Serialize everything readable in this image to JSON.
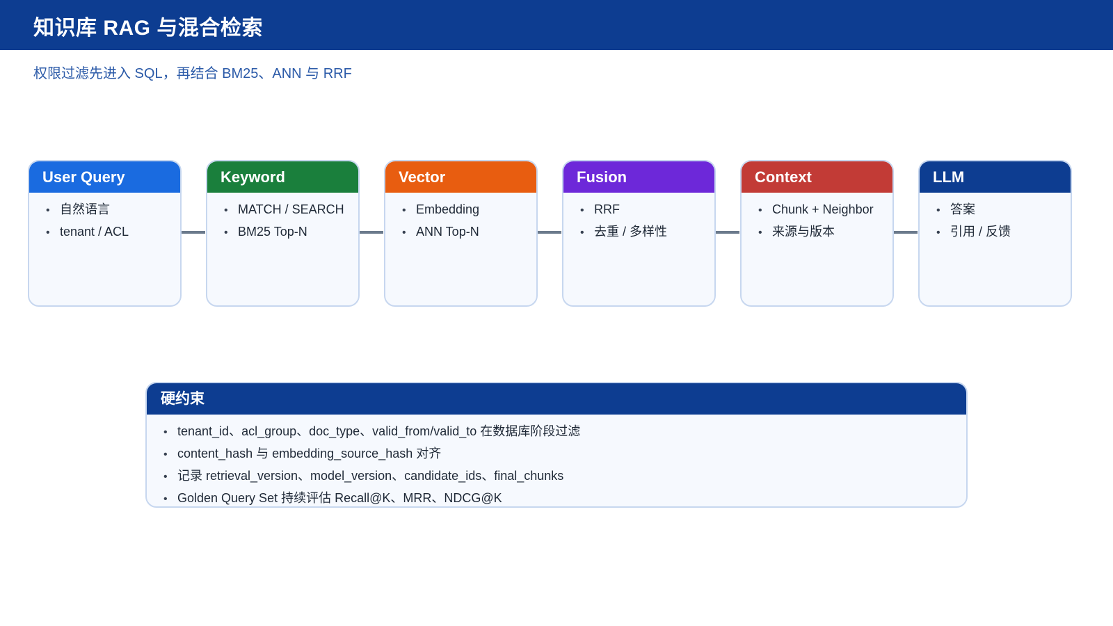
{
  "header": {
    "title": "知识库 RAG 与混合检索",
    "subtitle": "权限过滤先进入 SQL，再结合 BM25、ANN 与 RRF"
  },
  "pipeline": [
    {
      "title": "User Query",
      "color": "#1a6be0",
      "items": [
        "自然语言",
        "tenant / ACL"
      ]
    },
    {
      "title": "Keyword",
      "color": "#1a7f3c",
      "items": [
        "MATCH / SEARCH",
        "BM25 Top-N"
      ]
    },
    {
      "title": "Vector",
      "color": "#e85d10",
      "items": [
        "Embedding",
        "ANN Top-N"
      ]
    },
    {
      "title": "Fusion",
      "color": "#6d28d9",
      "items": [
        "RRF",
        "去重 / 多样性"
      ]
    },
    {
      "title": "Context",
      "color": "#c23b36",
      "items": [
        "Chunk + Neighbor",
        "来源与版本"
      ]
    },
    {
      "title": "LLM",
      "color": "#0d3d91",
      "items": [
        "答案",
        "引用 / 反馈"
      ]
    }
  ],
  "constraints": {
    "title": "硬约束",
    "items": [
      "tenant_id、acl_group、doc_type、valid_from/valid_to 在数据库阶段过滤",
      "content_hash 与 embedding_source_hash 对齐",
      "记录 retrieval_version、model_version、candidate_ids、final_chunks",
      "Golden Query Set 持续评估 Recall@K、MRR、NDCG@K"
    ]
  },
  "bullet_symbol": "•"
}
